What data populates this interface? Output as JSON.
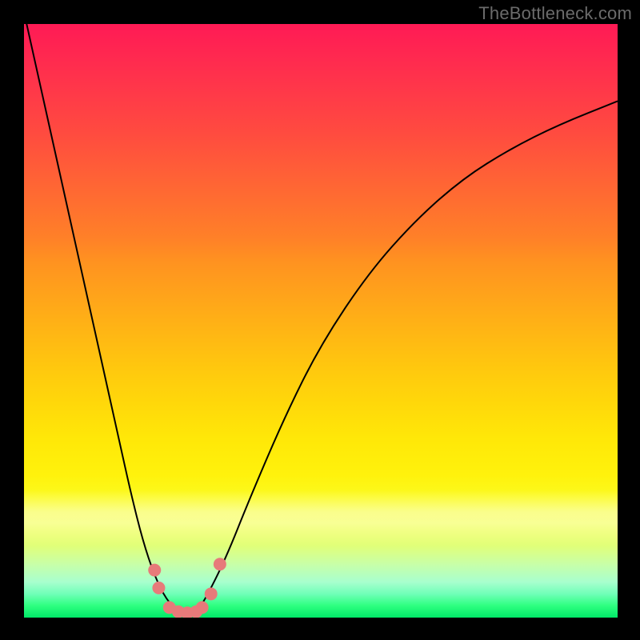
{
  "watermark": "TheBottleneck.com",
  "chart_data": {
    "type": "line",
    "title": "",
    "xlabel": "",
    "ylabel": "",
    "xlim": [
      0,
      100
    ],
    "ylim": [
      0,
      100
    ],
    "series": [
      {
        "name": "curve",
        "x": [
          0,
          4,
          8,
          12,
          16,
          18,
          20,
          22,
          24,
          26,
          27.5,
          29,
          30.5,
          34,
          38,
          44,
          50,
          58,
          66,
          74,
          82,
          90,
          100
        ],
        "y": [
          102,
          84,
          66,
          48,
          30,
          21,
          13,
          7,
          3,
          1,
          0.5,
          1,
          3,
          10,
          20,
          34,
          46,
          58,
          67,
          74,
          79,
          83,
          87
        ]
      }
    ],
    "markers": [
      {
        "x": 22.0,
        "y": 8.0
      },
      {
        "x": 22.7,
        "y": 5.0
      },
      {
        "x": 24.5,
        "y": 1.7
      },
      {
        "x": 26.0,
        "y": 1.0
      },
      {
        "x": 27.5,
        "y": 0.8
      },
      {
        "x": 29.0,
        "y": 1.0
      },
      {
        "x": 30.0,
        "y": 1.7
      },
      {
        "x": 31.5,
        "y": 4.0
      },
      {
        "x": 33.0,
        "y": 9.0
      }
    ],
    "marker_color": "#e77a7a",
    "curve_color": "#000000"
  }
}
